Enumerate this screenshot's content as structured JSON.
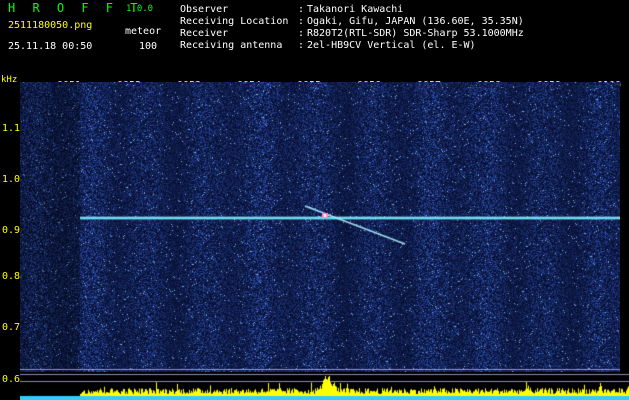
{
  "header": {
    "app_title": "H R O F F T",
    "version": "1.0.0",
    "filename": "2511180050.png",
    "meteor_label": "meteor",
    "datetime": "25.11.18 00:50",
    "meteor_count": "100"
  },
  "info": [
    {
      "label": "Observer",
      "sep": ":",
      "value": "Takanori Kawachi"
    },
    {
      "label": "Receiving Location",
      "sep": ":",
      "value": "Ogaki, Gifu, JAPAN (136.60E, 35.35N)"
    },
    {
      "label": "Receiver",
      "sep": ":",
      "value": "R820T2(RTL-SDR) SDR-Sharp 53.1000MHz"
    },
    {
      "label": "Receiving antenna",
      "sep": ":",
      "value": "2el-HB9CV Vertical (el. E-W)"
    }
  ],
  "axis": {
    "unit": "kHz",
    "y_ticks": [
      "1.1",
      "1.0",
      "0.9",
      "0.8",
      "0.7",
      "0.6"
    ],
    "x_ticks": [
      "0051",
      "0052",
      "0053",
      "0054",
      "0055",
      "0056",
      "0057",
      "0058",
      "0059",
      "0100"
    ]
  },
  "colors": {
    "background": "#000000",
    "plot_base": "#101a50",
    "text_white": "#ffffff",
    "text_yellow": "#ffff00",
    "text_green": "#00ff00",
    "carrier": "#66ddee",
    "histogram": "#ffff00",
    "baseline": "#33ccff"
  }
}
